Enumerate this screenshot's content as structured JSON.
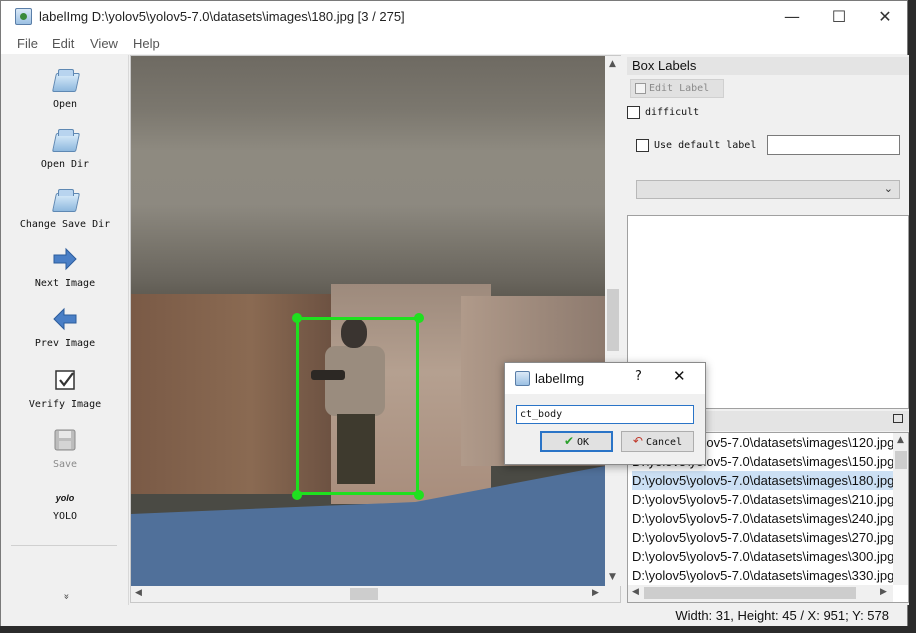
{
  "window": {
    "title": "labelImg D:\\yolov5\\yolov5-7.0\\datasets\\images\\180.jpg [3 / 275]",
    "minimize": "—",
    "maximize": "☐",
    "close": "✕"
  },
  "menu": [
    "File",
    "Edit",
    "View",
    "Help"
  ],
  "toolbar": {
    "open": "Open",
    "open_dir": "Open Dir",
    "change_save_dir": "Change Save Dir",
    "next_image": "Next Image",
    "prev_image": "Prev Image",
    "verify_image": "Verify Image",
    "save": "Save",
    "yolo_icon_text": "yolo",
    "yolo": "YOLO",
    "more": "»"
  },
  "box_labels": {
    "title": "Box Labels",
    "edit_label": "Edit Label",
    "difficult": "difficult",
    "use_default_label": "Use default label",
    "default_label_value": "",
    "combo_value": ""
  },
  "file_list": {
    "items": [
      "D:\\yolov5\\yolov5-7.0\\datasets\\images\\120.jpg",
      "D:\\yolov5\\yolov5-7.0\\datasets\\images\\150.jpg",
      "D:\\yolov5\\yolov5-7.0\\datasets\\images\\180.jpg",
      "D:\\yolov5\\yolov5-7.0\\datasets\\images\\210.jpg",
      "D:\\yolov5\\yolov5-7.0\\datasets\\images\\240.jpg",
      "D:\\yolov5\\yolov5-7.0\\datasets\\images\\270.jpg",
      "D:\\yolov5\\yolov5-7.0\\datasets\\images\\300.jpg",
      "D:\\yolov5\\yolov5-7.0\\datasets\\images\\330.jpg"
    ],
    "selected_index": 2
  },
  "status": "Width: 31, Height: 45 / X: 951; Y: 578",
  "dialog": {
    "title": "labelImg",
    "help": "?",
    "close": "✕",
    "input_value": "ct_body",
    "ok": "OK",
    "cancel": "Cancel"
  },
  "colors": {
    "bbox": "#1fe01f",
    "accent": "#2a74c7",
    "selected_row": "#cce0f4"
  }
}
